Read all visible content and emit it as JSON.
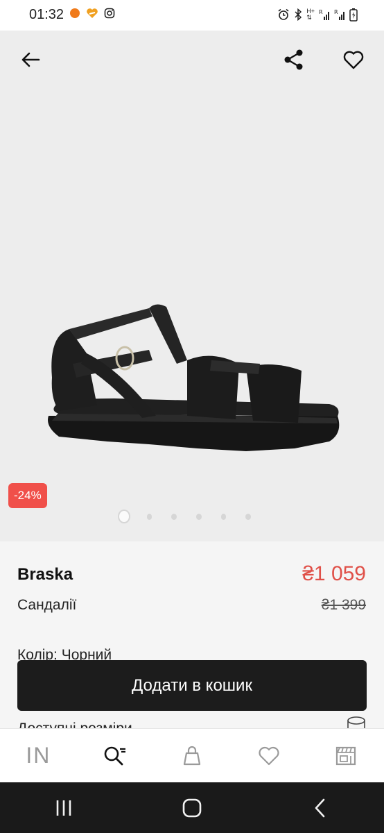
{
  "status_bar": {
    "time": "01:32",
    "icons_left": [
      "notification-dot-icon",
      "app-heart-icon",
      "instagram-icon"
    ],
    "icons_right": [
      "alarm-icon",
      "bluetooth-icon",
      "signal-h-plus-icon",
      "signal-r-icon",
      "signal-r-icon",
      "battery-charging-icon"
    ],
    "signal_labels": [
      "H+",
      "R",
      "R"
    ]
  },
  "product": {
    "discount": "-24%",
    "brand": "Braska",
    "type": "Сандалії",
    "current_price": "₴1 059",
    "old_price": "₴1 399",
    "color": "Колір: Чорний",
    "sizes_label": "Доступні розміри",
    "image_count": 6,
    "active_image_index": 0
  },
  "actions": {
    "add_to_cart": "Додати в кошик"
  },
  "bottom_nav": {
    "items": [
      {
        "name": "home",
        "label": "IN",
        "icon": "brand-logo"
      },
      {
        "name": "search",
        "icon": "search-icon"
      },
      {
        "name": "cart",
        "icon": "shopping-bag-icon"
      },
      {
        "name": "favorites",
        "icon": "heart-icon"
      },
      {
        "name": "catalog",
        "icon": "store-icon"
      }
    ]
  },
  "colors": {
    "accent_price": "#e05048",
    "badge": "#f0504a",
    "button": "#1c1c1c",
    "hero_bg": "#ededed"
  }
}
